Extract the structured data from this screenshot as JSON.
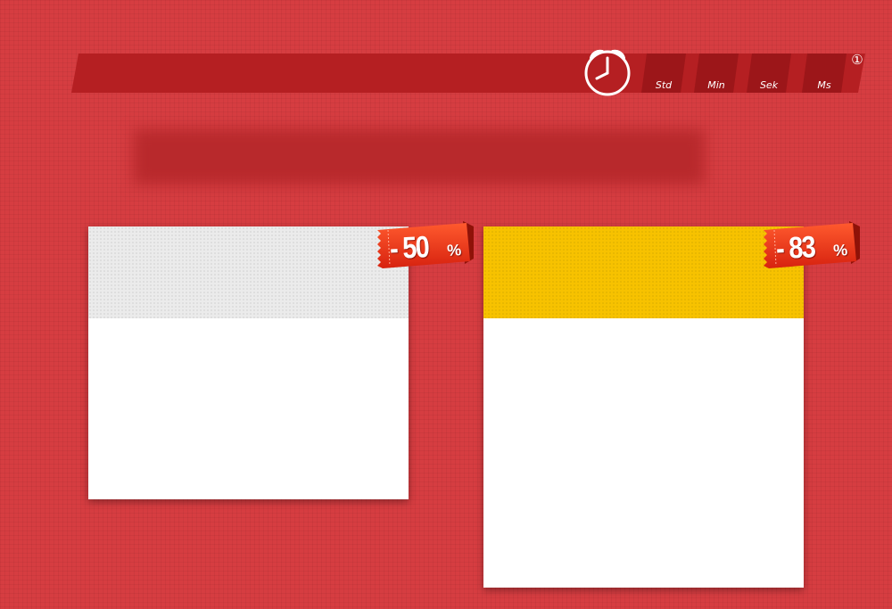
{
  "timer": {
    "units": [
      {
        "label": "Std"
      },
      {
        "label": "Min"
      },
      {
        "label": "Sek"
      },
      {
        "label": "Ms"
      }
    ],
    "info_glyph": "①",
    "clock_icon": "alarm-clock-icon",
    "bar_color": "#b51f22",
    "box_color": "#9c1619"
  },
  "offers": [
    {
      "discount_number": "- 50",
      "discount_suffix": "%",
      "header_color": "#ebebeb"
    },
    {
      "discount_number": "- 83",
      "discount_suffix": "%",
      "header_color": "#f7c200"
    }
  ],
  "colors": {
    "background": "#d63d41",
    "ribbon": "#e2321a",
    "card": "#ffffff"
  }
}
